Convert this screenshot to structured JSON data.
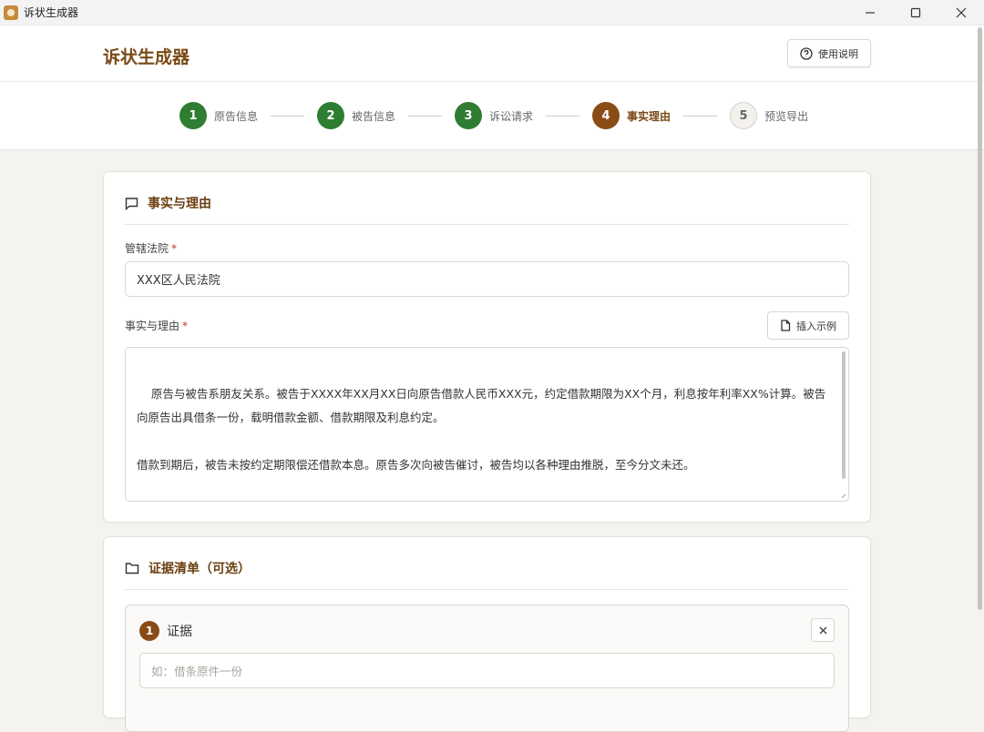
{
  "window": {
    "title": "诉状生成器",
    "icons": {
      "app": "app-icon",
      "minimize": "minimize-icon",
      "maximize": "maximize-icon",
      "close": "close-icon"
    }
  },
  "header": {
    "brand": "诉状生成器",
    "help_label": "使用说明",
    "help_icon": "question-circle-icon",
    "brand_color": "#7a4a17"
  },
  "stepper": {
    "steps": [
      {
        "number": "1",
        "label": "原告信息",
        "status": "done"
      },
      {
        "number": "2",
        "label": "被告信息",
        "status": "done"
      },
      {
        "number": "3",
        "label": "诉讼请求",
        "status": "done"
      },
      {
        "number": "4",
        "label": "事实理由",
        "status": "current"
      },
      {
        "number": "5",
        "label": "预览导出",
        "status": "pending"
      }
    ],
    "colors": {
      "done": "#2f7d32",
      "current": "#8a4c16"
    }
  },
  "facts_card": {
    "title": "事实与理由",
    "title_icon": "message-square-icon",
    "court": {
      "label": "管辖法院",
      "required": "*",
      "value": "XXX区人民法院"
    },
    "facts": {
      "label": "事实与理由",
      "required": "*",
      "insert_label": "插入示例",
      "insert_icon": "file-icon",
      "text": "原告与被告系朋友关系。被告于XXXX年XX月XX日向原告借款人民币XXX元，约定借款期限为XX个月，利息按年利率XX%计算。被告向原告出具借条一份，载明借款金额、借款期限及利息约定。\n\n借款到期后，被告未按约定期限偿还借款本息。原告多次向被告催讨，被告均以各种理由推脱，至今分文未还。\n\n根据《中华人民共和国民法典》第六百七十四条、第六百七十五条、第六百七十六条规定，借款人应当按照约定的期限返还借款，借款人未按照约定的期限返还借款的，应当按照约定或者国家有关规定支付逾期利息。被告的行为已构成违约，应当承担偿还借款本息的民事责任。"
    }
  },
  "evidence_card": {
    "title": "证据清单（可选）",
    "title_icon": "folder-icon",
    "items": [
      {
        "number": "1",
        "title": "证据",
        "placeholder": "如：借条原件一份",
        "remove_icon": "close-x-icon"
      }
    ]
  }
}
